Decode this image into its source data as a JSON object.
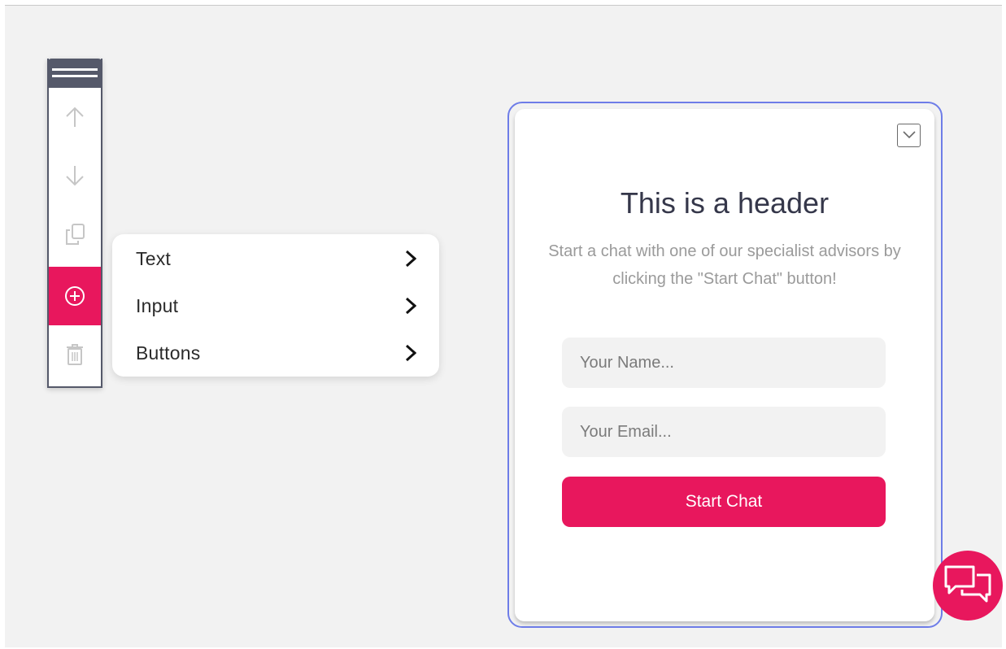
{
  "toolbar": {
    "buttons": [
      {
        "icon": "arrow-up-icon",
        "action": "move-up"
      },
      {
        "icon": "arrow-down-icon",
        "action": "move-down"
      },
      {
        "icon": "duplicate-icon",
        "action": "duplicate"
      },
      {
        "icon": "add-circle-icon",
        "action": "add",
        "active": true
      },
      {
        "icon": "trash-icon",
        "action": "delete"
      }
    ]
  },
  "add_menu": {
    "items": [
      {
        "label": "Text"
      },
      {
        "label": "Input"
      },
      {
        "label": "Buttons"
      }
    ]
  },
  "widget": {
    "header": "This is a header",
    "subtext": "Start a chat with one of our specialist advisors by clicking the \"Start Chat\" button!",
    "name_field": {
      "placeholder": "Your Name...",
      "value": ""
    },
    "email_field": {
      "placeholder": "Your Email...",
      "value": ""
    },
    "start_button_label": "Start Chat"
  },
  "colors": {
    "accent": "#e8175d",
    "toolbar_dark": "#55596a",
    "selection_outline": "#6e7de8",
    "background": "#f2f2f2"
  }
}
